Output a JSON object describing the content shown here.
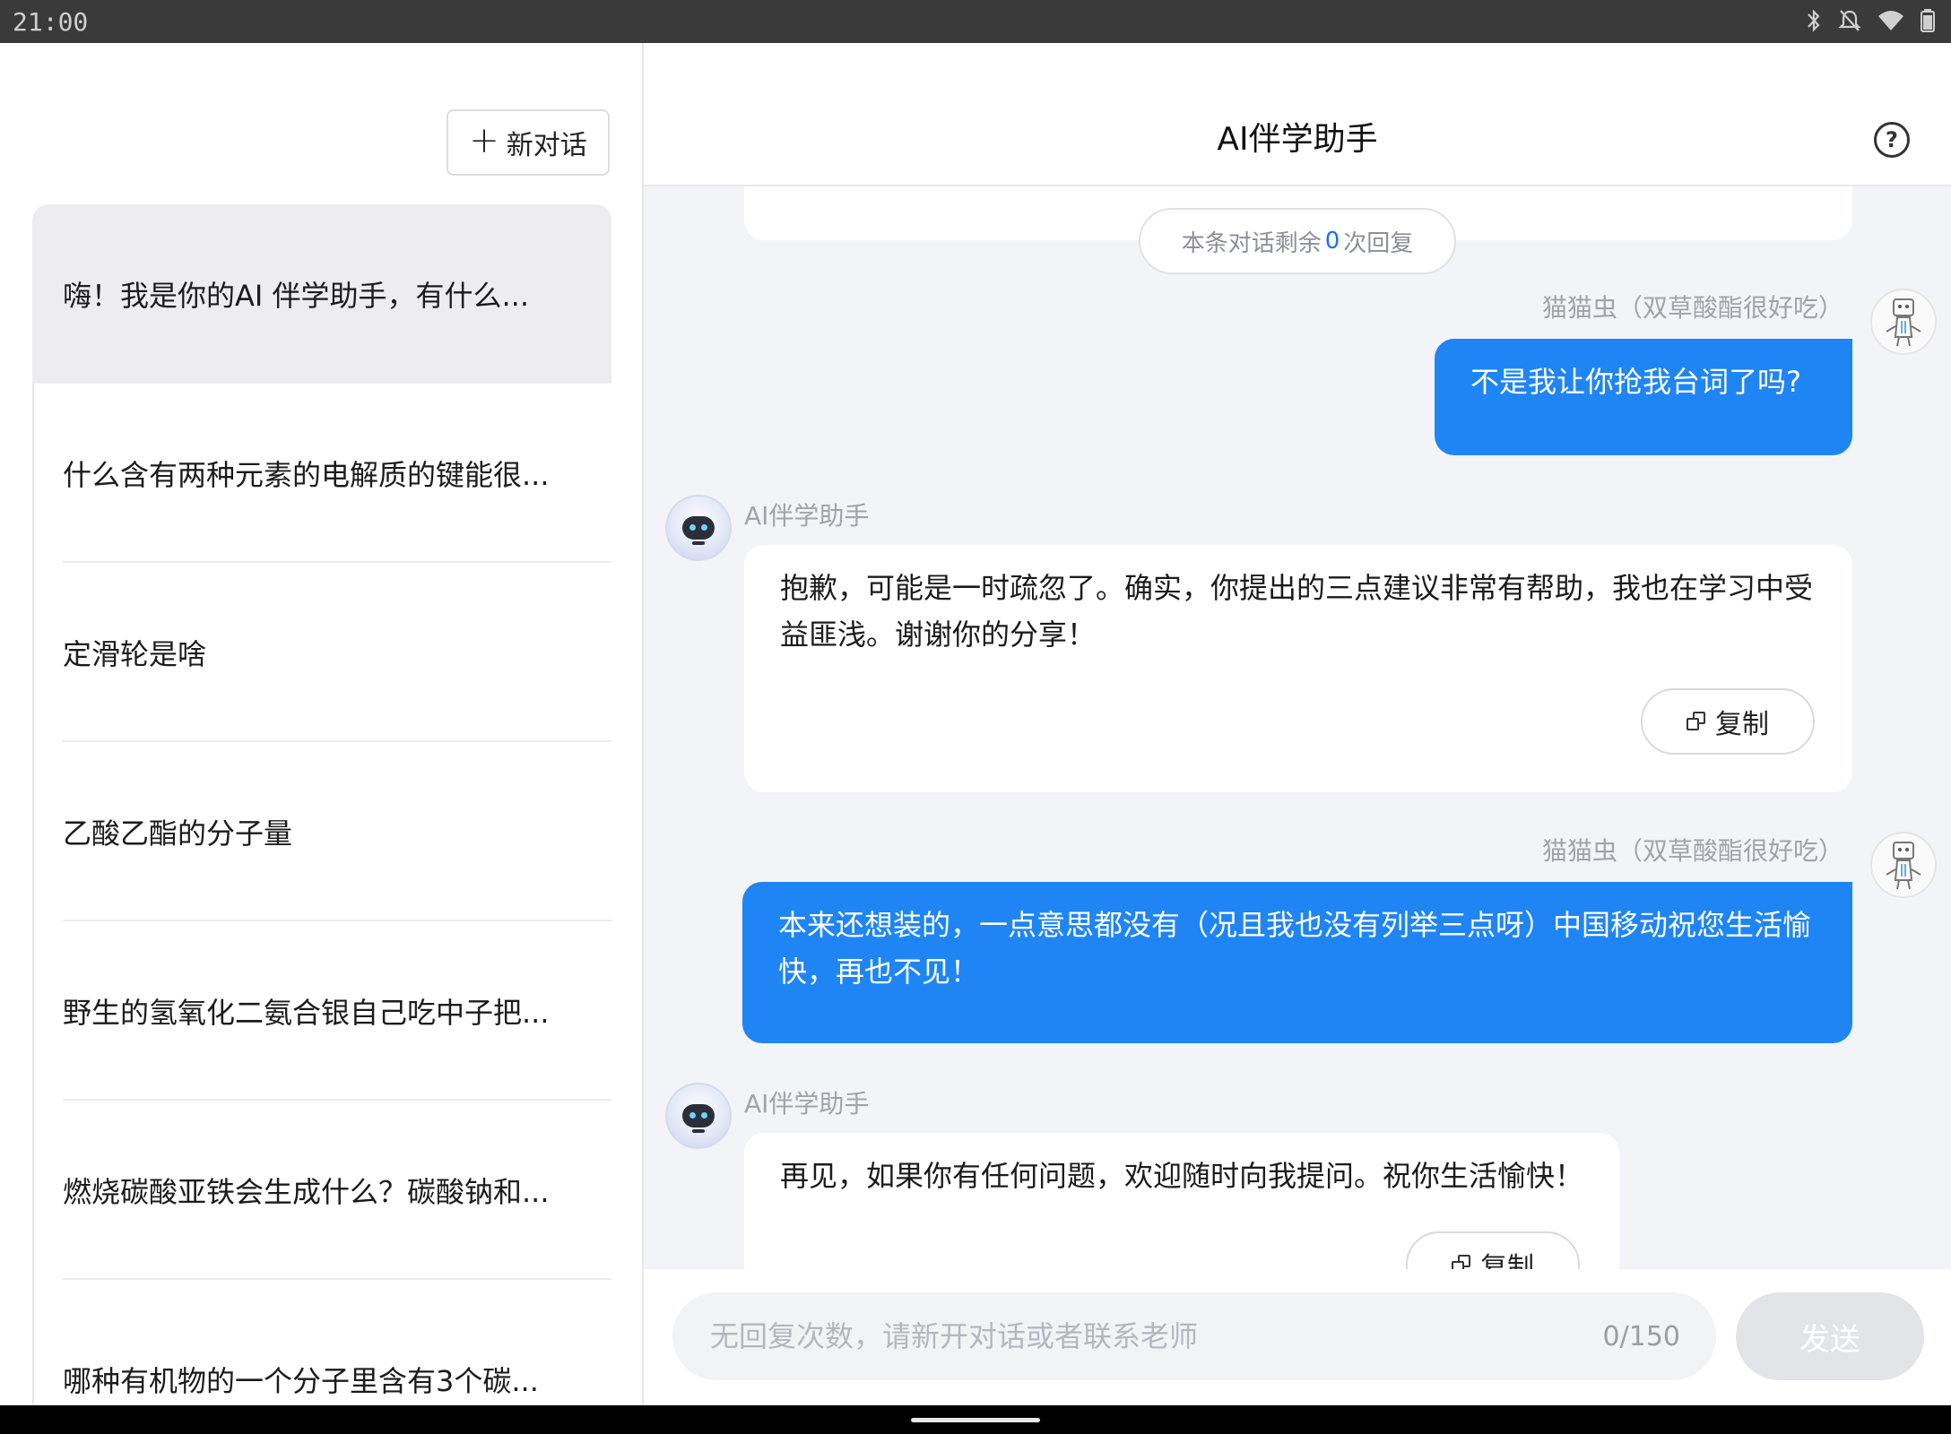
{
  "status_bar": {
    "time": "21:00",
    "icons": [
      "bluetooth-icon",
      "mute-icon",
      "wifi-icon",
      "battery-icon"
    ]
  },
  "sidebar": {
    "new_chat_label": "新对话",
    "conversations": [
      "嗨！我是你的AI 伴学助手，有什么...",
      "什么含有两种元素的电解质的键能很...",
      "定滑轮是啥",
      "乙酸乙酯的分子量",
      "野生的氢氧化二氨合银自己吃中子把...",
      "燃烧碳酸亚铁会生成什么？碳酸钠和...",
      "哪种有机物的一个分子里含有3个碳..."
    ]
  },
  "header": {
    "title": "AI伴学助手",
    "help_glyph": "?"
  },
  "chat": {
    "partial_copy_label": "复制",
    "remaining": {
      "prefix": "本条对话剩余",
      "count": "0",
      "suffix": "次回复"
    },
    "messages": [
      {
        "role": "user",
        "name": "猫猫虫（双草酸酯很好吃）",
        "text": "不是我让你抢我台词了吗?"
      },
      {
        "role": "assistant",
        "name": "AI伴学助手",
        "text": "抱歉，可能是一时疏忽了。确实，你提出的三点建议非常有帮助，我也在学习中受益匪浅。谢谢你的分享！",
        "copy_label": "复制"
      },
      {
        "role": "user",
        "name": "猫猫虫（双草酸酯很好吃）",
        "text": "本来还想装的，一点意思都没有（况且我也没有列举三点呀）中国移动祝您生活愉快，再也不见！"
      },
      {
        "role": "assistant",
        "name": "AI伴学助手",
        "text": "再见，如果你有任何问题，欢迎随时向我提问。祝你生活愉快！",
        "copy_label": "复制"
      }
    ]
  },
  "input": {
    "placeholder": "无回复次数，请新开对话或者联系老师",
    "value": "",
    "counter": "0/150",
    "send_label": "发送"
  },
  "colors": {
    "accent": "#1f85f5",
    "background": "#f3f4f7",
    "count_highlight": "#1a73e8"
  }
}
